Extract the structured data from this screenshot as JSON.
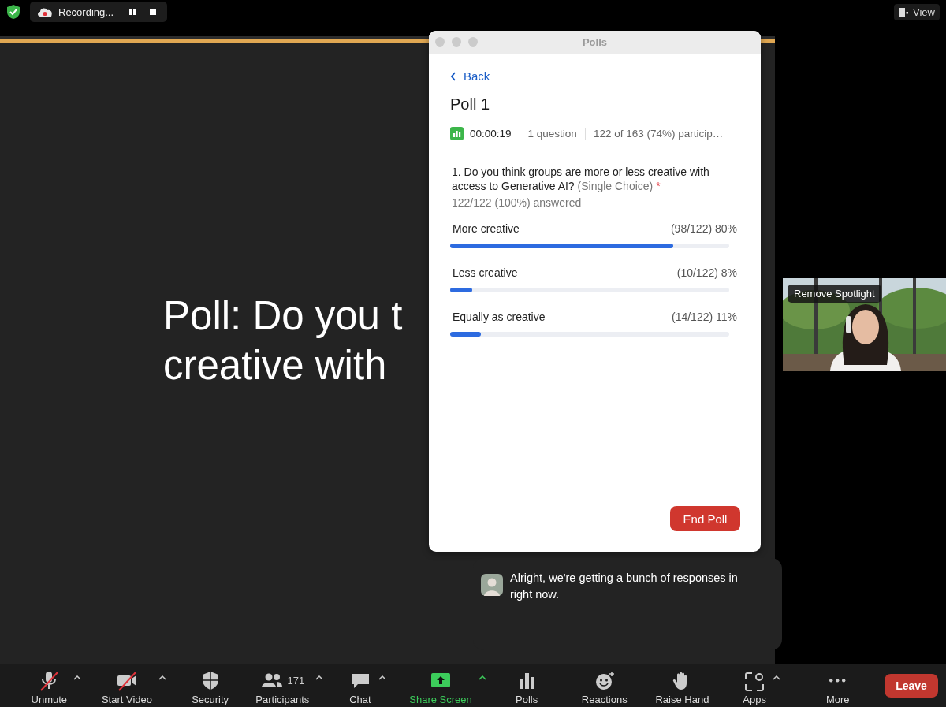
{
  "top_bar": {
    "recording": {
      "label": "Recording..."
    },
    "view_button": {
      "label": "View"
    }
  },
  "slide": {
    "lines": [
      "Poll: Do you t",
      "creative with"
    ]
  },
  "poll_window": {
    "title": "Polls",
    "back": "Back",
    "poll_title": "Poll 1",
    "timer": "00:00:19",
    "question_count": "1 question",
    "participation": "122 of 163 (74%) particip…",
    "question": {
      "text": "1. Do you think groups are more or less creative with access to Generative AI?",
      "type": "(Single Choice)",
      "required_mark": "*",
      "answered": "122/122 (100%) answered"
    },
    "options": [
      {
        "label": "More creative",
        "result": "(98/122) 80%",
        "level": 0.8
      },
      {
        "label": "Less creative",
        "result": "(10/122) 8%",
        "level": 0.08
      },
      {
        "label": "Equally as creative",
        "result": "(14/122) 11%",
        "level": 0.11
      }
    ],
    "end_button": "End Poll"
  },
  "video_tile": {
    "kind": "picture",
    "spotlight_label": "Remove Spotlight"
  },
  "chat_bubble": {
    "message": "Alright, we're getting a bunch of responses in right now."
  },
  "toolbar": {
    "items": [
      {
        "kind": "mic",
        "label": "Unmute",
        "crossed": true,
        "caret": true,
        "active": false
      },
      {
        "kind": "video",
        "label": "Start Video",
        "crossed": true,
        "caret": true,
        "active": false
      },
      {
        "kind": "shield",
        "label": "Security",
        "active": false
      },
      {
        "kind": "people",
        "label": "Participants",
        "count": "171",
        "caret": true,
        "active": false
      },
      {
        "kind": "chat",
        "label": "Chat",
        "caret": true,
        "active": false
      },
      {
        "kind": "share",
        "label": "Share Screen",
        "caret": true,
        "active": true
      },
      {
        "kind": "bars",
        "label": "Polls",
        "active": false
      },
      {
        "kind": "smiley",
        "label": "Reactions",
        "active": false
      },
      {
        "kind": "hand",
        "label": "Raise Hand",
        "active": false
      },
      {
        "kind": "apps",
        "label": "Apps",
        "caret": true,
        "active": false
      },
      {
        "kind": "dots",
        "label": "More",
        "active": false
      }
    ],
    "leave": "Leave"
  }
}
